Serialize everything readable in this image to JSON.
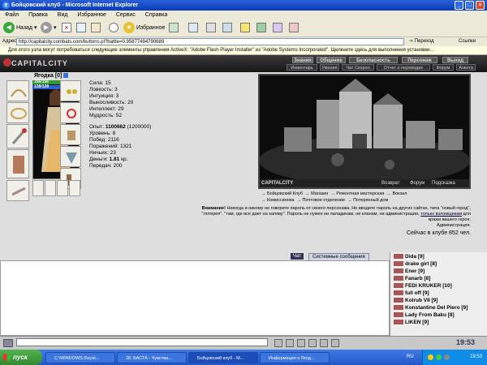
{
  "window": {
    "title": "Бойцовский клуб - Microsoft Internet Explorer"
  },
  "menu": {
    "items": [
      "Файл",
      "Правка",
      "Вид",
      "Избранное",
      "Сервис",
      "Справка"
    ]
  },
  "toolbar": {
    "back": "Назад",
    "favorites": "Избранное"
  },
  "address": {
    "label": "Адрес:",
    "url": "http://capitalcity.combats.com/buttons.pl?battle=0.95877494790689",
    "go": "Переход",
    "links": "Ссылки"
  },
  "infobar": {
    "text": "Для этого узла могут потребоваться следующие элементы управления ActiveX: \"Adobe Flash Player Installer\" из \"Adobe Systems Incorporated\". Щелкните здесь для выполнения установки..."
  },
  "game": {
    "logo": "CAPITALCITY",
    "nav_top": [
      "Знания",
      "Общение",
      "Безопасность",
      "Персонаж",
      "Выход"
    ],
    "nav_sub": [
      "Инвентарь",
      "Умения",
      "Чат Скорол",
      "Отчет о переводах",
      "Форум",
      "Анкета"
    ],
    "character": {
      "name": "Ягодка [0]",
      "hp": "156/156",
      "mp": "128/128",
      "attributes": [
        "Сила: 15",
        "Ловкость: 3",
        "Интуиция: 3",
        "Выносливость: 20",
        "Интеллект: 29",
        "Мудрость: 52"
      ],
      "exp_label": "Опыт:",
      "exp_value": "1100662",
      "exp_next": "(1200000)",
      "level": "Уровень: 8",
      "wins": "Побед: 2116",
      "losses": "Поражений: 1321",
      "draws": "Ничьих: 23",
      "money_label": "Деньги:",
      "money_value": "1.81",
      "money_unit": "кр.",
      "transfers": "Передач: 200"
    },
    "city": {
      "logo": "CAPITALCITY",
      "footer": [
        "Возврат",
        "Форум",
        "Подсказка"
      ],
      "links": [
        "Бойцовский Клуб",
        "Магазин",
        "Ремонтная мастерская",
        "Вокзал",
        "Комиссионка",
        "Почтовое отделение",
        "Потерянный дом"
      ]
    },
    "warning": {
      "bold": "Внимание!",
      "text": "Никогда и никому не говорите пароль от своего персонажа. Не вводите пароль на других сайтах, типа \"новый город\", \"лотерея\", \"там, где все дает на халяву\". Пароль не нужен ни паладинам, ни кланам, ни администрации,",
      "link": "только взломщикам",
      "tail": "для кражи вашего героя.",
      "sign": "Администрация.",
      "online": "Сейчас в клубе 852 чел."
    },
    "chat": {
      "tabs": [
        "Чат",
        "Системные сообщения"
      ],
      "users": [
        "Dida [9]",
        "drake girl [8]",
        "Ener [9]",
        "Fanarb [8]",
        "FEDI KRUKER [10]",
        "full off [9]",
        "Kolrub VII [9]",
        "Konstantine Del Piero [9]",
        "Lady From Baku [8]",
        "LIKEN [9]"
      ],
      "clock": "19:53"
    }
  },
  "taskbar": {
    "start": "пуск",
    "tasks": [
      "C:\\WINDOWS.0\\syst...",
      "28. БАСТА - Чувства...",
      "Бойцовский клуб - M...",
      "Информация о Ягод..."
    ],
    "lang": "RU",
    "time": "19:53"
  },
  "colors": {
    "hp": "#2f9a2f",
    "mp": "#2a5fd8",
    "title": "#0a3cb8",
    "taskbar": "#2457c8"
  }
}
